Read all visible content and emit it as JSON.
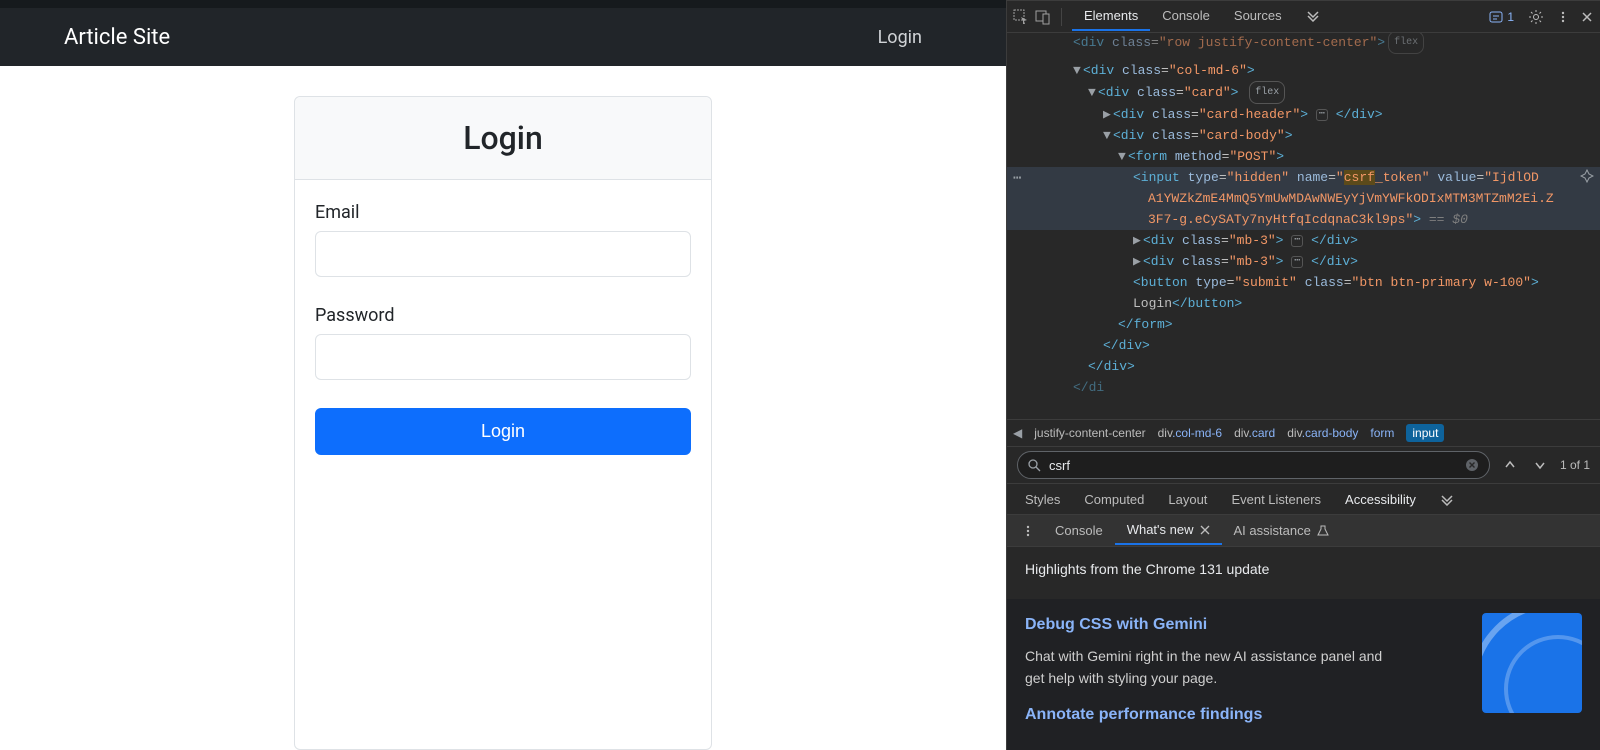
{
  "app": {
    "brand": "Article Site",
    "nav_login": "Login",
    "card_title": "Login",
    "email_label": "Email",
    "password_label": "Password",
    "login_button": "Login"
  },
  "devtools": {
    "top_tabs": [
      "Elements",
      "Console",
      "Sources"
    ],
    "active_top_tab": "Elements",
    "issues_count": "1",
    "dom": {
      "l0": "<div class=\"row justify-content-center\">",
      "l0_pill": "flex",
      "l1": "<div class=\"col-md-6\">",
      "l2": "<div class=\"card\">",
      "l2_pill": "flex",
      "l3": "<div class=\"card-header\">",
      "l3_end": "</div>",
      "l4": "<div class=\"card-body\">",
      "l5": "<form method=\"POST\">",
      "l6a": "<input type=\"hidden\" name=\"",
      "l6_match": "csrf",
      "l6b": "_token\" value=\"IjdlOD",
      "l6c": "A1YWZkZmE4MmQ5YmUwMDAwNWEyYjVmYWFkODIxMTM3MTZmM2Ei.Z",
      "l6d": "3F7-g.eCySATy7nyHtfqIcdqnaC3kl9ps\">",
      "l6_eq": " == $0",
      "l7": "<div class=\"mb-3\">",
      "l7_end": "</div>",
      "l8": "<div class=\"mb-3\">",
      "l8_end": "</div>",
      "l9": "<button type=\"submit\" class=\"btn btn-primary w-100\">",
      "l9_text": "Login",
      "l9_end": "</button>",
      "l10": "</form>",
      "l11": "</div>",
      "l12": "</div>",
      "l13": "/di"
    },
    "crumbs": [
      "justify-content-center",
      "div.col-md-6",
      "div.card",
      "div.card-body",
      "form",
      "input"
    ],
    "search_value": "csrf",
    "search_count": "1 of 1",
    "styles_tabs": [
      "Styles",
      "Computed",
      "Layout",
      "Event Listeners",
      "Accessibility"
    ],
    "drawer_tabs": [
      "Console",
      "What's new",
      "AI assistance"
    ],
    "drawer_active": "What's new",
    "whatsnew": {
      "headline": "Highlights from the Chrome 131 update",
      "h1": "Debug CSS with Gemini",
      "p1": "Chat with Gemini right in the new AI assistance panel and get help with styling your page.",
      "h2": "Annotate performance findings"
    }
  }
}
